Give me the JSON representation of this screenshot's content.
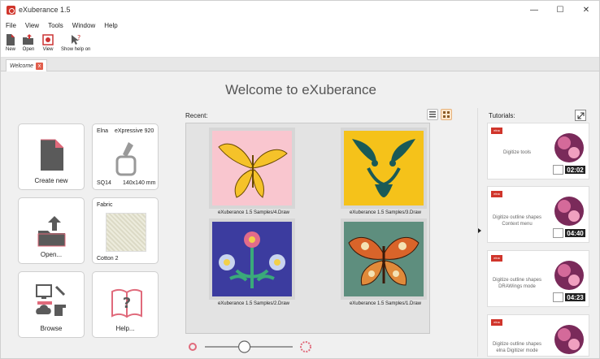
{
  "window": {
    "title": "eXuberance 1.5",
    "minimize": "—",
    "maximize": "☐",
    "close": "✕"
  },
  "menu": [
    "File",
    "View",
    "Tools",
    "Window",
    "Help"
  ],
  "toolbar": {
    "new_label": "New",
    "open_label": "Open",
    "view_label": "View",
    "help_label": "Show help on"
  },
  "tabs": [
    {
      "label": "Welcome",
      "close": "x"
    }
  ],
  "main": {
    "title": "Welcome to eXuberance"
  },
  "tiles": {
    "create_new": "Create new",
    "machine": {
      "brand": "Elna",
      "model": "eXpressive 920",
      "hoop": "SQ14",
      "size": "140x140 mm"
    },
    "open": "Open...",
    "fabric": {
      "heading": "Fabric",
      "name": "Cotton 2"
    },
    "browse": "Browse",
    "help": "Help..."
  },
  "recent": {
    "label": "Recent:",
    "items": [
      {
        "caption": "eXuberance 1.5 Samples/4.Draw",
        "icon": "butterfly-yellow"
      },
      {
        "caption": "eXuberance 1.5 Samples/3.Draw",
        "icon": "tribal-face"
      },
      {
        "caption": "eXuberance 1.5 Samples/2.Draw",
        "icon": "flower-pattern"
      },
      {
        "caption": "eXuberance 1.5 Samples/1.Draw",
        "icon": "moth-orange"
      }
    ]
  },
  "tutorials": {
    "label": "Tutorials:",
    "items": [
      {
        "title": "Digitize tools",
        "time": "02:02"
      },
      {
        "title": "Digitize outline shapes Context menu",
        "time": "04:40"
      },
      {
        "title": "Digitize outline shapes DRAWings mode",
        "time": "04:23"
      },
      {
        "title": "Digitize outline shapes elna Digitizer mode",
        "time": ""
      }
    ],
    "logo_text": "elna"
  },
  "zoom": {
    "level": 0.45
  },
  "colors": {
    "accent": "#d0352b",
    "tile_icon": "#e06a7b"
  }
}
